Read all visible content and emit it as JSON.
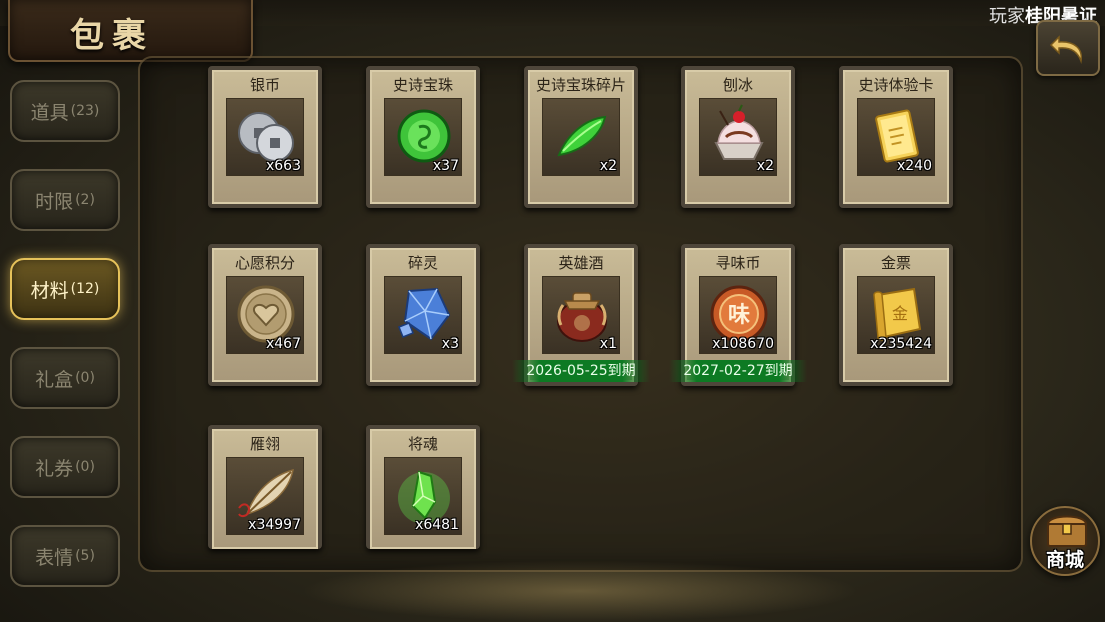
{
  "header": {
    "title": "包裹",
    "player_prefix": "玩家",
    "player_name": "桂阳暑证"
  },
  "tabs": [
    {
      "label": "道具",
      "count": "(23)",
      "active": false
    },
    {
      "label": "时限",
      "count": "(2)",
      "active": false
    },
    {
      "label": "材料",
      "count": "(12)",
      "active": true
    },
    {
      "label": "礼盒",
      "count": "(0)",
      "active": false
    },
    {
      "label": "礼券",
      "count": "(0)",
      "active": false
    },
    {
      "label": "表情",
      "count": "(5)",
      "active": false
    }
  ],
  "items": [
    {
      "name": "银币",
      "qty": "x663",
      "icon": "silver-coin-icon"
    },
    {
      "name": "史诗宝珠",
      "qty": "x37",
      "icon": "green-orb-icon"
    },
    {
      "name": "史诗宝珠碎片",
      "qty": "x2",
      "icon": "green-shard-icon"
    },
    {
      "name": "刨冰",
      "qty": "x2",
      "icon": "shaved-ice-icon"
    },
    {
      "name": "史诗体验卡",
      "qty": "x240",
      "icon": "gold-card-icon"
    },
    {
      "name": "心愿积分",
      "qty": "x467",
      "icon": "heart-coin-icon"
    },
    {
      "name": "碎灵",
      "qty": "x3",
      "icon": "blue-crystal-icon"
    },
    {
      "name": "英雄酒",
      "qty": "x1",
      "icon": "wine-jar-icon",
      "expiry": "2026-05-25到期"
    },
    {
      "name": "寻味币",
      "qty": "x108670",
      "icon": "flavor-coin-icon",
      "expiry": "2027-02-27到期"
    },
    {
      "name": "金票",
      "qty": "x235424",
      "icon": "gold-scroll-icon"
    },
    {
      "name": "雁翎",
      "qty": "x34997",
      "icon": "feather-icon"
    },
    {
      "name": "将魂",
      "qty": "x6481",
      "icon": "green-soul-crystal-icon"
    }
  ],
  "mall": {
    "label": "商城",
    "icon": "treasure-chest-icon"
  },
  "back": {
    "icon": "back-arrow-icon"
  },
  "colors": {
    "accent": "#e6c25a",
    "expiry_green": "#0d7a23",
    "card_bg": "#c9bb97"
  }
}
